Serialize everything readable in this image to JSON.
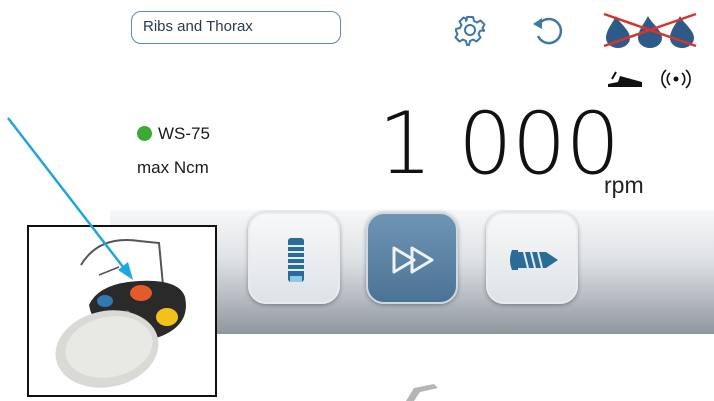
{
  "header": {
    "procedure": "Ribs and Thorax",
    "settings_icon": "gear-icon",
    "reverse_icon": "rotate-icon",
    "irrigation_icon": "irrigation-off-icon"
  },
  "status": {
    "pedal_icon": "foot-pedal-icon",
    "wireless_icon": "wireless-icon"
  },
  "motor": {
    "name": "WS-75",
    "status_color": "#3aaa35",
    "torque_label": "max Ncm"
  },
  "speed": {
    "value": "1 000",
    "unit": "rpm"
  },
  "modes": [
    {
      "icon": "drill-icon",
      "active": false
    },
    {
      "icon": "fast-forward-icon",
      "active": true
    },
    {
      "icon": "screw-icon",
      "active": false
    }
  ],
  "colors": {
    "accent": "#5b82a3",
    "annotation": "#1fa6e0",
    "irrigation": "#2d5a86",
    "cross": "#d8342c"
  }
}
